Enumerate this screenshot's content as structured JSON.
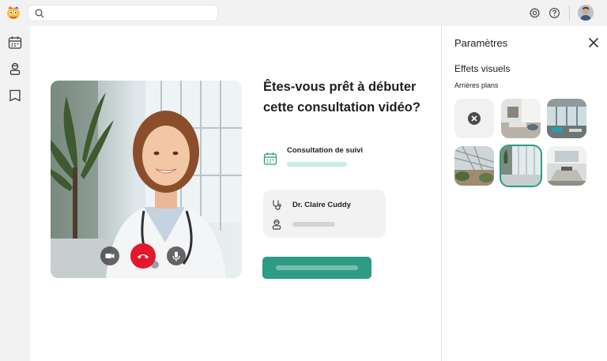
{
  "app": {
    "search": {
      "value": "",
      "placeholder": ""
    }
  },
  "main": {
    "headline": "Êtes-vous prêt à débuter cette consultation vidéo?",
    "consultation_label": "Consultation de suivi",
    "doctor_name": "Dr. Claire Cuddy"
  },
  "settings": {
    "title": "Paramètres",
    "section": "Effets visuels",
    "subsection": "Arrières plans",
    "backgrounds": [
      {
        "name": "none",
        "selected": false
      },
      {
        "name": "office-lounge",
        "selected": false
      },
      {
        "name": "glass-office",
        "selected": false
      },
      {
        "name": "atrium",
        "selected": false
      },
      {
        "name": "corridor",
        "selected": true
      },
      {
        "name": "meeting-room",
        "selected": false
      }
    ]
  },
  "colors": {
    "accent": "#2c9c84",
    "hangup": "#e3182d",
    "chrome": "#f2f2f3"
  },
  "icons": [
    "search-icon",
    "gear-icon",
    "help-icon",
    "calendar-icon",
    "patient-icon",
    "bookmark-icon",
    "camera-icon",
    "hangup-icon",
    "microphone-icon",
    "stethoscope-icon",
    "person-icon",
    "close-icon"
  ]
}
